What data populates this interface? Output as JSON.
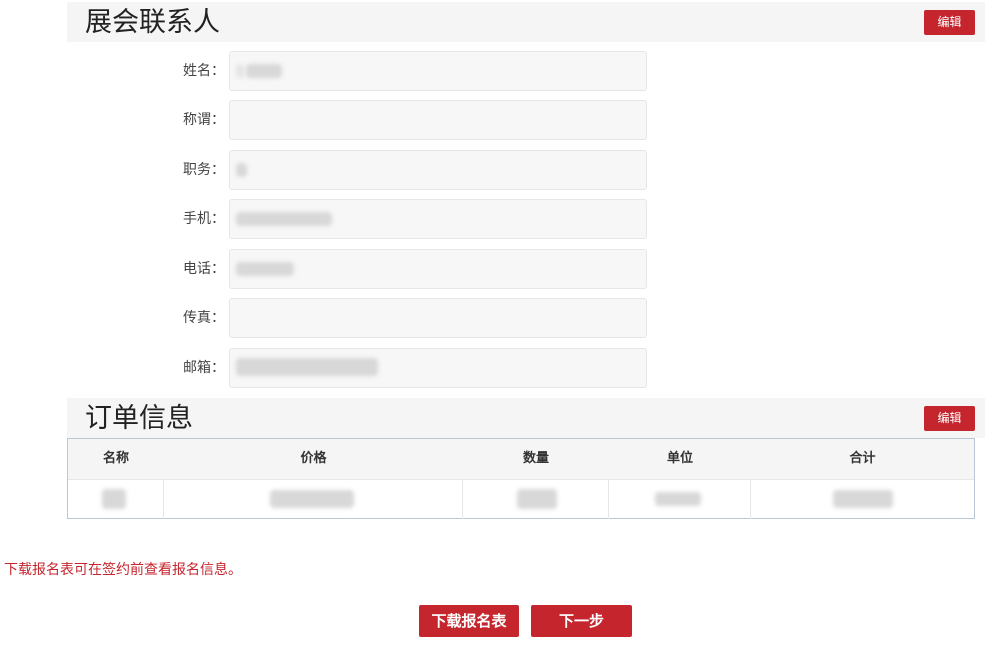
{
  "contact_section": {
    "title": "展会联系人",
    "edit_label": "编辑",
    "fields": [
      {
        "label": "姓名："
      },
      {
        "label": "称谓："
      },
      {
        "label": "职务："
      },
      {
        "label": "手机："
      },
      {
        "label": "电话："
      },
      {
        "label": "传真："
      },
      {
        "label": "邮箱："
      }
    ]
  },
  "order_section": {
    "title": "订单信息",
    "edit_label": "编辑",
    "columns": [
      "名称",
      "价格",
      "数量",
      "单位",
      "合计"
    ]
  },
  "note": "下载报名表可在签约前查看报名信息。",
  "buttons": {
    "download": "下载报名表",
    "next": "下一步"
  },
  "colors": {
    "accent": "#c5262e",
    "header_bg": "#f5f5f5",
    "input_bg": "#f7f7f7"
  }
}
